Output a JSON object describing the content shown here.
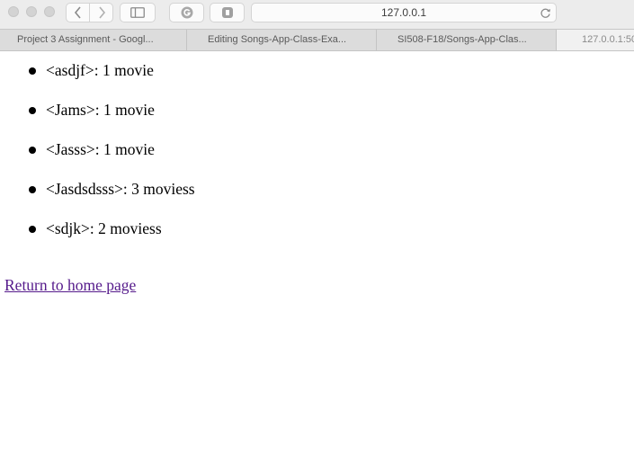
{
  "browser": {
    "address": "127.0.0.1",
    "tabs": [
      {
        "label": "Project 3 Assignment - Googl..."
      },
      {
        "label": "Editing Songs-App-Class-Exa..."
      },
      {
        "label": "SI508-F18/Songs-App-Clas..."
      },
      {
        "label": "127.0.0.1:50"
      }
    ]
  },
  "page": {
    "items": [
      {
        "text": "<asdjf>: 1 movie"
      },
      {
        "text": "<Jams>: 1 movie"
      },
      {
        "text": "<Jasss>: 1 movie"
      },
      {
        "text": "<Jasdsdsss>: 3 moviess"
      },
      {
        "text": "<sdjk>: 2 moviess"
      }
    ],
    "home_link": "Return to home page"
  },
  "colors": {
    "link_visited": "#551a8b"
  }
}
